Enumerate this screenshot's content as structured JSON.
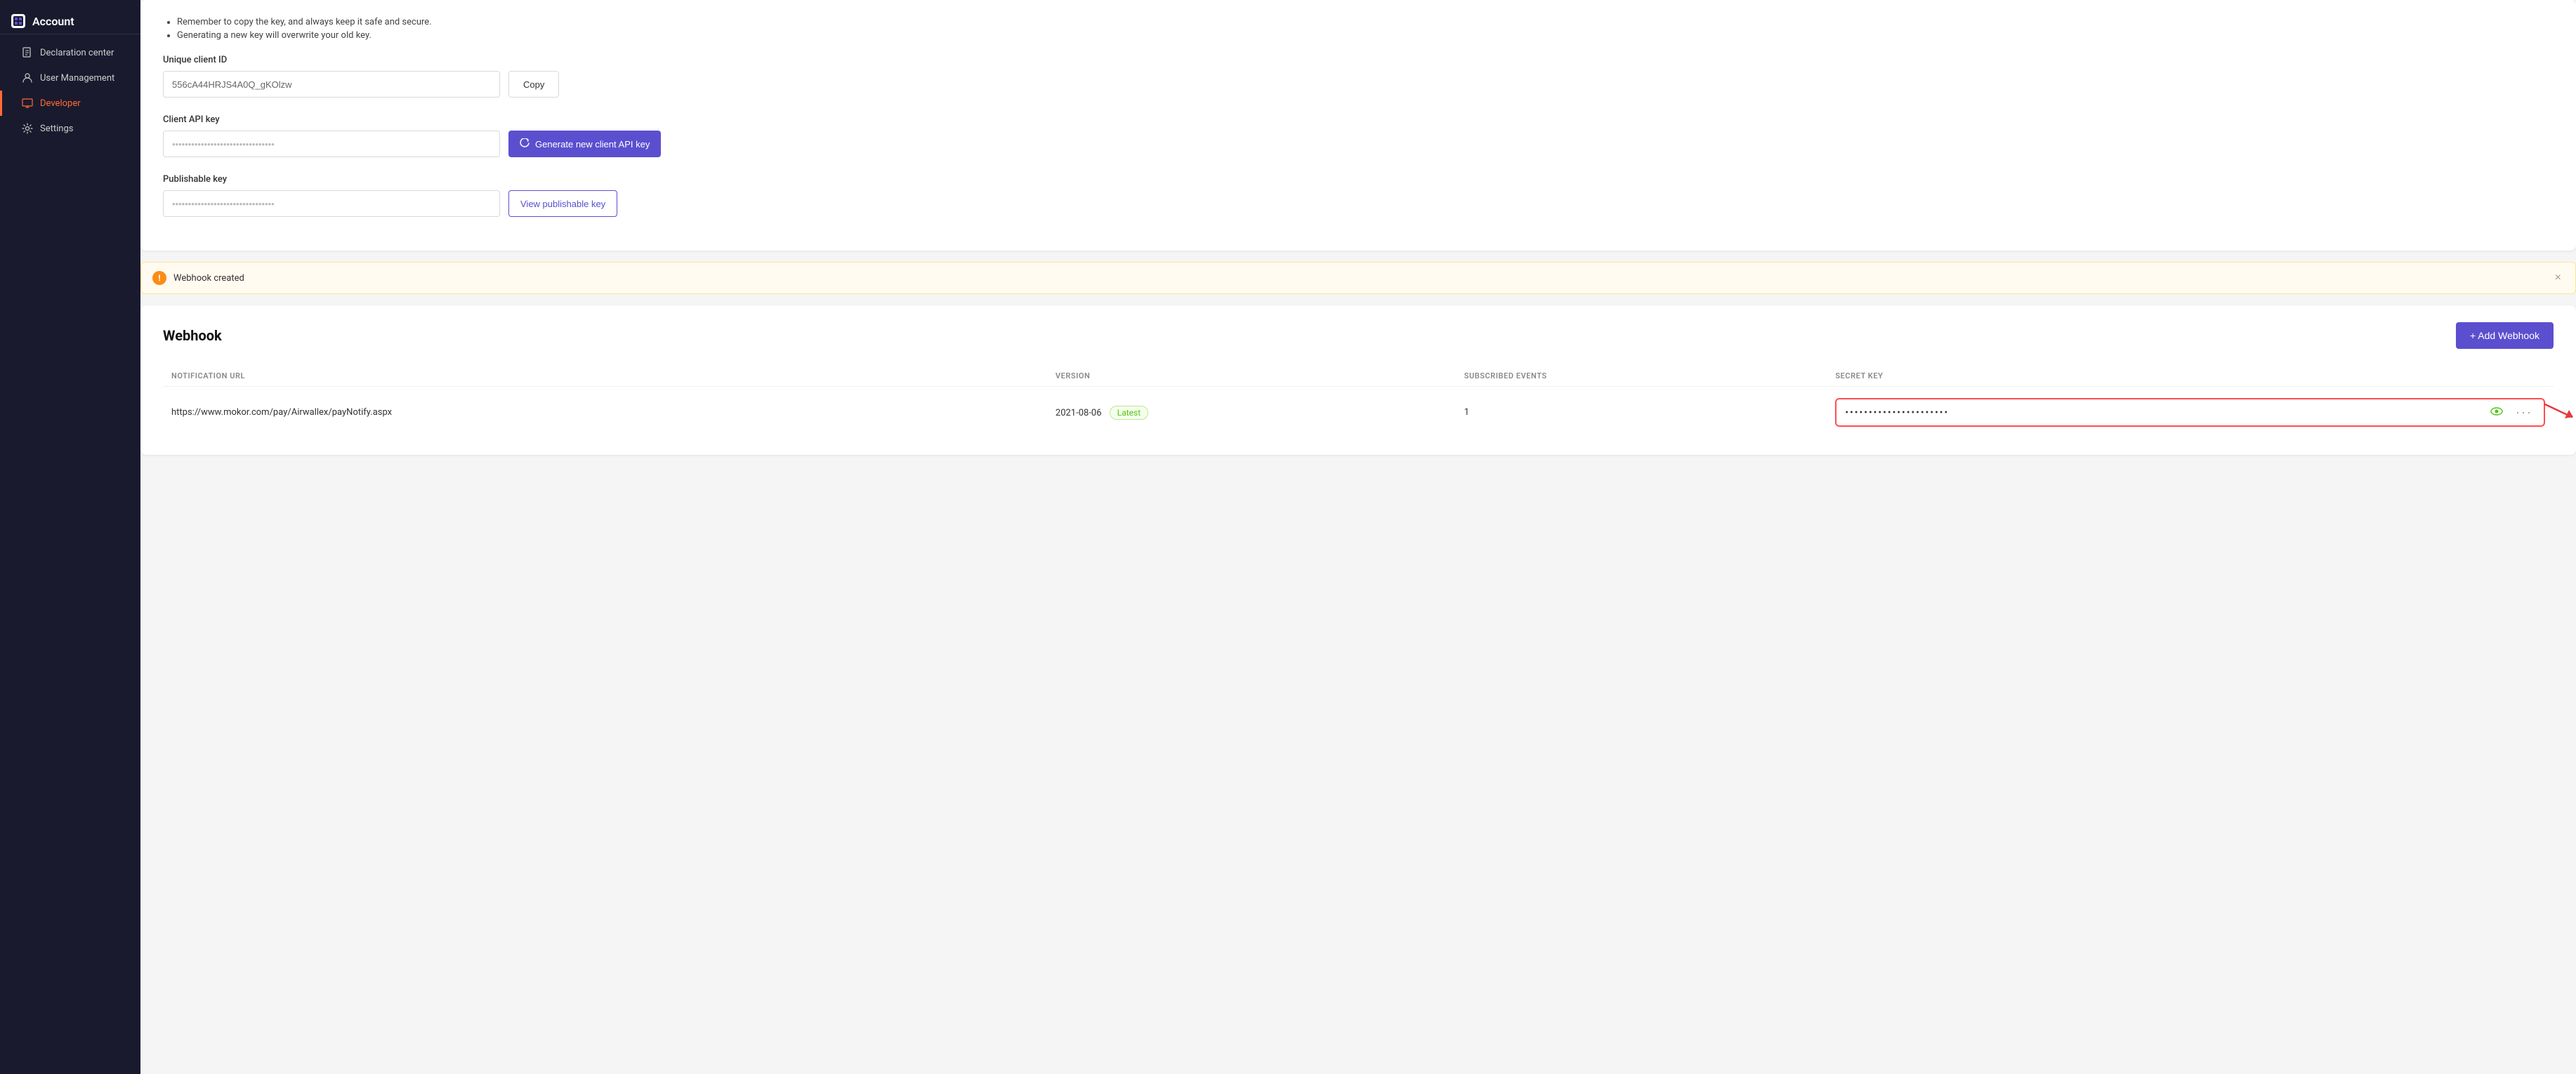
{
  "sidebar": {
    "logo_text": "Account",
    "items": [
      {
        "id": "declaration-center",
        "label": "Declaration center",
        "icon": "file-icon",
        "active": false
      },
      {
        "id": "user-management",
        "label": "User Management",
        "icon": "user-icon",
        "active": false
      },
      {
        "id": "developer",
        "label": "Developer",
        "icon": "monitor-icon",
        "active": true
      },
      {
        "id": "settings",
        "label": "Settings",
        "icon": "gear-icon",
        "active": false
      }
    ]
  },
  "api_section": {
    "notices": [
      "Remember to copy the key, and always keep it safe and secure.",
      "Generating a new key will overwrite your old key."
    ],
    "unique_client_id": {
      "label": "Unique client ID",
      "value": "556cA44HRJS4A0Q_gKOlzw",
      "copy_btn": "Copy"
    },
    "client_api_key": {
      "label": "Client API key",
      "placeholder": "••••••••••••••••••••••••••••••••",
      "generate_btn": "Generate new client API key"
    },
    "publishable_key": {
      "label": "Publishable key",
      "placeholder": "••••••••••••••••••••••••••••••••",
      "view_btn": "View publishable key"
    }
  },
  "webhook_banner": {
    "message": "Webhook created",
    "close_label": "×"
  },
  "webhook_section": {
    "title": "Webhook",
    "add_btn": "+ Add Webhook",
    "table": {
      "columns": [
        {
          "id": "notification-url",
          "label": "NOTIFICATION URL"
        },
        {
          "id": "version",
          "label": "VERSION"
        },
        {
          "id": "subscribed-events",
          "label": "SUBSCRIBED EVENTS"
        },
        {
          "id": "secret-key",
          "label": "SECRET KEY"
        }
      ],
      "rows": [
        {
          "notification_url": "https://www.mokor.com/pay/Airwallex/payNotify.aspx",
          "version": "2021-08-06",
          "version_badge": "Latest",
          "subscribed_events": "1",
          "secret_key_dots": "••••••••••••••••••••••"
        }
      ]
    }
  }
}
